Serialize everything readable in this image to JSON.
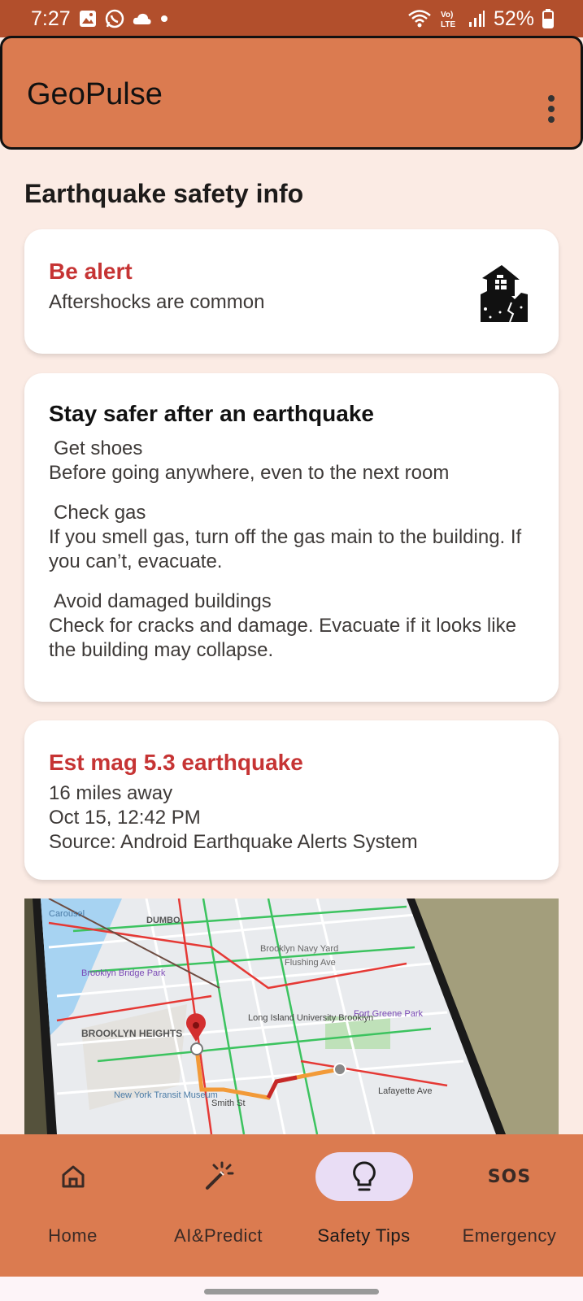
{
  "status_bar": {
    "time": "7:27",
    "battery": "52%",
    "icons": [
      "gallery-icon",
      "whatsapp-icon",
      "cloud-icon",
      "wifi-icon",
      "volte-icon",
      "signal-icon",
      "battery-icon"
    ],
    "lte_label": "Vo) LTE"
  },
  "app_bar": {
    "title": "GeoPulse",
    "menu_icon": "more-vert-icon"
  },
  "page_title": "Earthquake safety info",
  "alert_card": {
    "title": "Be alert",
    "subtitle": "Aftershocks are common",
    "icon": "damaged-house-icon"
  },
  "tips_card": {
    "title": "Stay safer after an earthquake",
    "tips": [
      {
        "heading": "Get shoes",
        "body": "Before going anywhere, even to the next room"
      },
      {
        "heading": "Check gas",
        "body": "If you smell gas, turn off the gas main to the building. If you can’t, evacuate."
      },
      {
        "heading": "Avoid damaged buildings",
        "body": "Check for cracks and damage. Evacuate if it looks like the building may collapse."
      }
    ]
  },
  "quake_card": {
    "title": "Est mag 5.3 earthquake",
    "distance": "16 miles away",
    "datetime": "Oct 15, 12:42 PM",
    "source": "Source: Android Earthquake Alerts System"
  },
  "map": {
    "labels": [
      "DUMBO",
      "Brooklyn Navy Yard",
      "Flushing Ave",
      "Brooklyn Bridge Park",
      "BROOKLYN HEIGHTS",
      "Long Island University Brooklyn",
      "Fort Greene Park",
      "New York Transit Museum",
      "Smith St",
      "Lafayette Ave",
      "Carousel"
    ]
  },
  "bottom_nav": {
    "items": [
      {
        "label": "Home",
        "icon": "home-icon",
        "active": false
      },
      {
        "label": "AI&Predict",
        "icon": "magic-wand-icon",
        "active": false
      },
      {
        "label": "Safety Tips",
        "icon": "lightbulb-icon",
        "active": true
      },
      {
        "label": "Emergency",
        "icon": "sos-icon",
        "active": false
      }
    ],
    "sos_text": "SOS"
  },
  "colors": {
    "status_bar": "#b24f2c",
    "app_bar": "#db7b50",
    "background": "#fbebe4",
    "accent_red": "#c63434",
    "active_pill": "#e9ddf5"
  }
}
